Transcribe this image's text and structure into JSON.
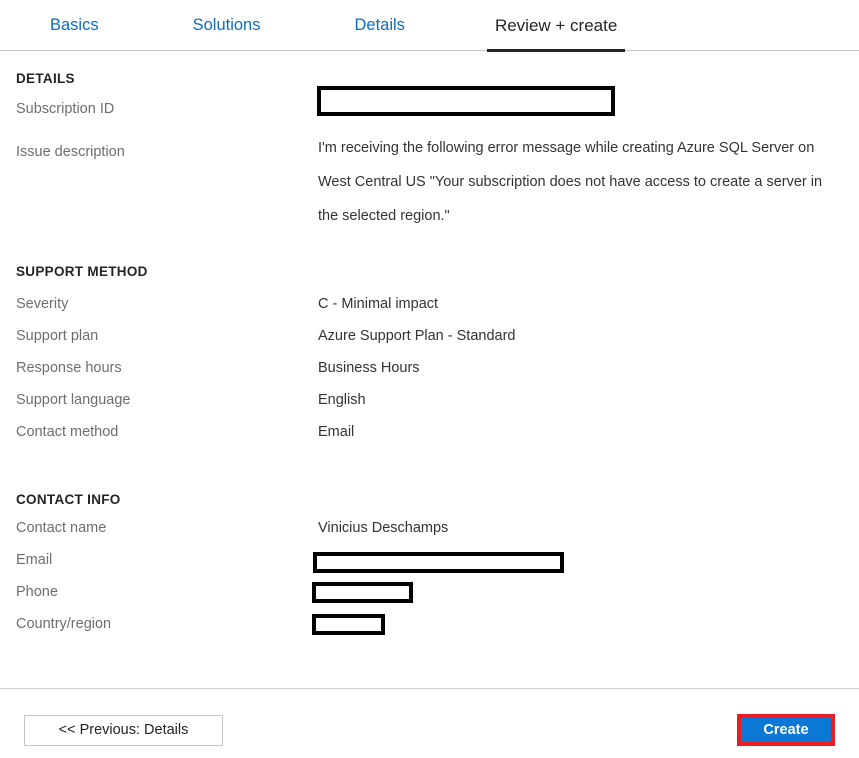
{
  "tabs": [
    {
      "label": "Basics",
      "active": false
    },
    {
      "label": "Solutions",
      "active": false
    },
    {
      "label": "Details",
      "active": false
    },
    {
      "label": "Review + create",
      "active": true
    }
  ],
  "sections": {
    "details": {
      "heading": "DETAILS",
      "rows": [
        {
          "label": "Subscription ID",
          "value": "",
          "redacted": true
        },
        {
          "label": "Issue description",
          "value": "I'm receiving the following error message while creating Azure SQL Server on West Central US \"Your subscription does not have access to create a server in the selected region.\"",
          "redacted": false
        }
      ]
    },
    "support_method": {
      "heading": "SUPPORT METHOD",
      "rows": [
        {
          "label": "Severity",
          "value": "C - Minimal impact"
        },
        {
          "label": "Support plan",
          "value": "Azure Support Plan - Standard"
        },
        {
          "label": "Response hours",
          "value": "Business Hours"
        },
        {
          "label": "Support language",
          "value": "English"
        },
        {
          "label": "Contact method",
          "value": "Email"
        }
      ]
    },
    "contact_info": {
      "heading": "CONTACT INFO",
      "rows": [
        {
          "label": "Contact name",
          "value": "Vinicius Deschamps",
          "redacted": false
        },
        {
          "label": "Email",
          "value": "",
          "redacted": true
        },
        {
          "label": "Phone",
          "value": "",
          "redacted": true
        },
        {
          "label": "Country/region",
          "value": "",
          "redacted": true
        }
      ]
    }
  },
  "footer": {
    "previous_label": "<< Previous: Details",
    "create_label": "Create"
  },
  "colors": {
    "tab_link": "#0c6dc0",
    "tab_active": "#252423",
    "label": "#6e6e6e",
    "value": "#333333",
    "create_button": "#0a78d4",
    "highlight_border": "#ed1c24",
    "redaction_border": "#000000"
  }
}
